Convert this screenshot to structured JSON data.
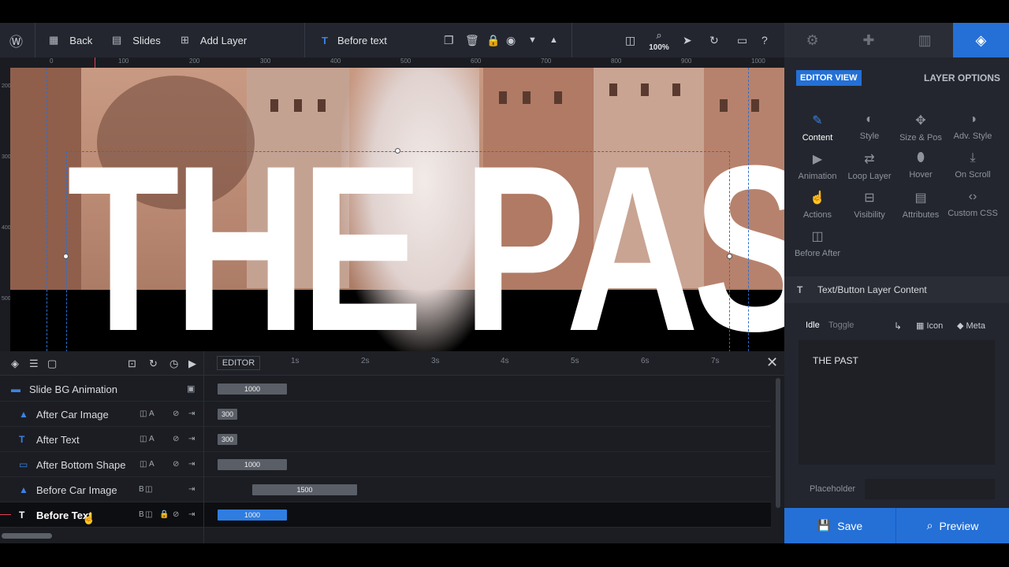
{
  "toolbar": {
    "back_label": "Back",
    "slides_label": "Slides",
    "add_layer_label": "Add Layer",
    "current_layer": "Before text",
    "zoom": "100%"
  },
  "ruler": {
    "ticks": [
      "0",
      "100",
      "200",
      "300",
      "400",
      "500",
      "600",
      "700",
      "800",
      "900",
      "1000"
    ],
    "vticks": [
      "200",
      "300",
      "400",
      "500"
    ]
  },
  "canvas": {
    "headline": "THE PAST"
  },
  "timeline": {
    "editor_label": "EDITOR",
    "seconds": [
      "1s",
      "2s",
      "3s",
      "4s",
      "5s",
      "6s",
      "7s"
    ],
    "rows": [
      {
        "label": "Slide BG Animation",
        "bar": "1000",
        "tag": ""
      },
      {
        "label": "After Car Image",
        "bar": "300",
        "tag": "A"
      },
      {
        "label": "After Text",
        "bar": "300",
        "tag": "A"
      },
      {
        "label": "After Bottom Shape",
        "bar": "1000",
        "tag": "A"
      },
      {
        "label": "Before Car Image",
        "bar": "1500",
        "tag": "B"
      },
      {
        "label": "Before Text",
        "bar": "1000",
        "tag": "B"
      }
    ]
  },
  "panel": {
    "editor_view": "EDITOR VIEW",
    "layer_options": "LAYER OPTIONS",
    "tabs": [
      {
        "label": "Content",
        "icon": "pencil-icon"
      },
      {
        "label": "Style",
        "icon": "palette-icon"
      },
      {
        "label": "Size & Pos",
        "icon": "move-icon"
      },
      {
        "label": "Adv. Style",
        "icon": "contrast-icon"
      },
      {
        "label": "Animation",
        "icon": "play-icon"
      },
      {
        "label": "Loop Layer",
        "icon": "loop-icon"
      },
      {
        "label": "Hover",
        "icon": "mouse-icon"
      },
      {
        "label": "On Scroll",
        "icon": "download-icon"
      },
      {
        "label": "Actions",
        "icon": "hand-icon"
      },
      {
        "label": "Visibility",
        "icon": "visibility-icon"
      },
      {
        "label": "Attributes",
        "icon": "document-icon"
      },
      {
        "label": "Custom CSS",
        "icon": "code-icon"
      },
      {
        "label": "Before After",
        "icon": "compare-icon"
      }
    ],
    "section_title": "Text/Button Layer Content",
    "idle": "Idle",
    "toggle": "Toggle",
    "icon_label": "Icon",
    "meta_label": "Meta",
    "content_text": "THE PAST",
    "placeholder_label": "Placeholder",
    "placeholder_value": "",
    "save_label": "Save",
    "preview_label": "Preview"
  }
}
